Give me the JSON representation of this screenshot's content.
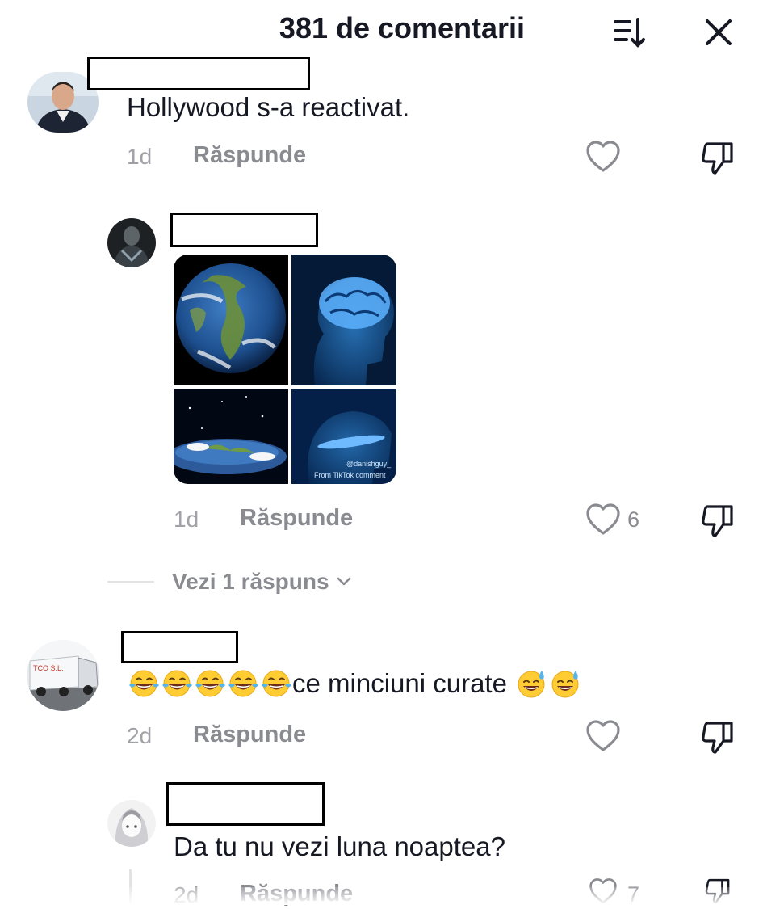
{
  "header": {
    "title": "381 de comentarii",
    "sort_icon": "sort-icon",
    "close_icon": "close-icon"
  },
  "comments": [
    {
      "text": "Hollywood s-a reactivat.",
      "time": "1d",
      "reply_label": "Răspunde",
      "likes": ""
    },
    {
      "text": "",
      "time": "1d",
      "reply_label": "Răspunde",
      "likes": "6",
      "image": "meme-grid-earth-brain-flat-earth"
    },
    {
      "view_replies": "Vezi 1 răspuns"
    },
    {
      "emoji_prefix_count": 5,
      "text": "ce minciuni curate",
      "emoji_suffix_count": 2,
      "time": "2d",
      "reply_label": "Răspunde",
      "likes": ""
    },
    {
      "text": "Da tu nu vezi luna noaptea?",
      "time": "2d",
      "reply_label": "Răspunde",
      "likes": "7"
    }
  ],
  "meme": {
    "watermark_user": "@danishguy_",
    "watermark_source": "From TikTok comment"
  },
  "colors": {
    "text": "#161823",
    "muted": "#8a8b91",
    "time": "#a1a2a7",
    "border": "#000000"
  }
}
